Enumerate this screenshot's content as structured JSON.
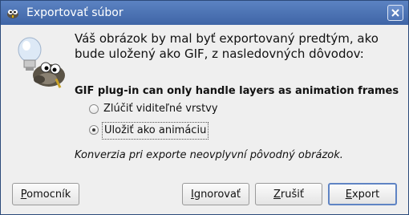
{
  "window": {
    "title": "Exportovať súbor"
  },
  "message": "Váš obrázok by mal byť exportovaný predtým, ako bude uložený ako GIF, z nasledovných dôvodov:",
  "plugin_message": "GIF plug-in can only handle layers as animation frames",
  "options": [
    {
      "label": "Zlúčiť viditeľné vrstvy",
      "checked": false
    },
    {
      "label": "Uložiť ako animáciu",
      "checked": true
    }
  ],
  "note": "Konverzia pri exporte neovplyvní pôvodný obrázok.",
  "buttons": {
    "help": {
      "mnemonic": "P",
      "rest": "omocník"
    },
    "ignore": {
      "mnemonic": "I",
      "rest": "gnorovať"
    },
    "cancel": {
      "mnemonic": "Z",
      "rest": "rušiť"
    },
    "export": {
      "mnemonic": "E",
      "rest": "xport"
    }
  },
  "icons": {
    "title_icon": "gimp-icon",
    "close": "close-icon",
    "mascot": "gimp-wilber-lightbulb-icon"
  },
  "colors": {
    "titlebar": "#4a70b0",
    "window_bg": "#efefef",
    "default_button_border": "#5f84c4"
  }
}
